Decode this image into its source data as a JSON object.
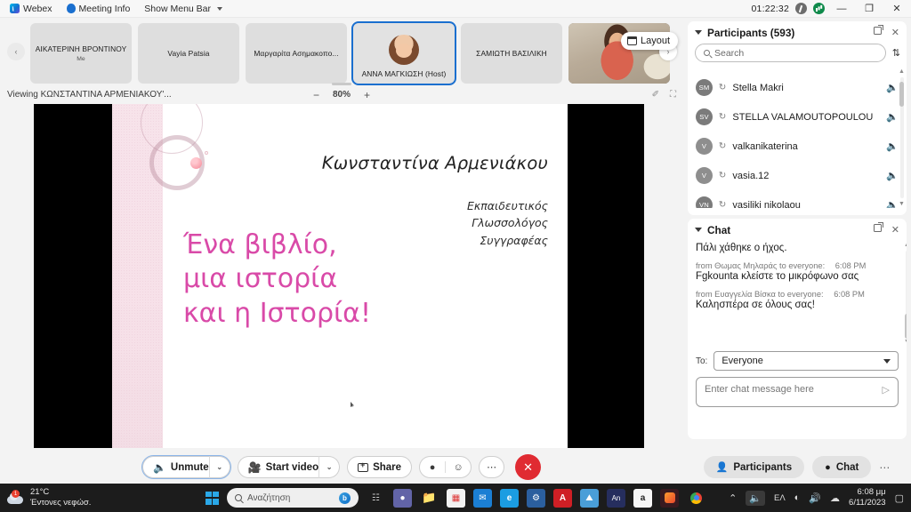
{
  "titlebar": {
    "app_name": "Webex",
    "meeting_info": "Meeting Info",
    "show_menu_bar": "Show Menu Bar",
    "timer": "01:22:32",
    "minimize": "—",
    "maximize": "❐",
    "close": "✕"
  },
  "thumbnails": {
    "prev_arrow": "‹",
    "next_arrow": "›",
    "layout_label": "Layout",
    "items": [
      {
        "name": "ΑΙΚΑΤΕΡΙΝΗ ΒΡΟΝΤΙΝΟΥ",
        "sub": "Me",
        "active": false,
        "video": false
      },
      {
        "name": "Vayia Patsia",
        "sub": "",
        "active": false,
        "video": false
      },
      {
        "name": "Μαργαρίτα Ασημακοπο...",
        "sub": "",
        "active": false,
        "video": false
      },
      {
        "name": "ΑΝΝΑ ΜΑΓΚΙΩΣΗ (Host)",
        "sub": "",
        "active": true,
        "video": false
      },
      {
        "name": "ΣΑΜΙΩΤΗ ΒΑΣΙΛΙΚΗ",
        "sub": "",
        "active": false,
        "video": false
      },
      {
        "name": "",
        "sub": "",
        "active": false,
        "video": true
      }
    ]
  },
  "viewbar": {
    "viewing_label": "Viewing ΚΩΝΣΤΑΝΤΙΝΑ ΑΡΜΕΝΙΑΚΟΥ'...",
    "zoom_out": "−",
    "zoom_level": "80%",
    "zoom_in": "+",
    "annotate_icon": "✐",
    "fullscreen_icon": "⛶"
  },
  "slide": {
    "author": "Κωνσταντίνα Αρμενιάκου",
    "role1": "Εκπαιδευτικός",
    "role2": "Γλωσσολόγος",
    "role3": "Συγγραφέας",
    "line1": "Ένα βιβλίο,",
    "line2": "μια ιστορία",
    "line3": "και η Ιστορία!",
    "title_color": "#d94aa8"
  },
  "controls": {
    "unmute": "Unmute",
    "unmute_chevron": "⌄",
    "start_video": "Start video",
    "video_chevron": "⌄",
    "share": "Share",
    "reactions_icon": "●",
    "emoji_icon": "☺",
    "more_icon": "⋯",
    "end_icon": "✕"
  },
  "participants_panel": {
    "title": "Participants (593)",
    "search_placeholder": "Search",
    "sort_icon": "⇅",
    "popout_icon": "popout",
    "close_icon": "✕",
    "list": [
      {
        "initials": "SM",
        "name": "Stella Makri",
        "muted": true
      },
      {
        "initials": "SV",
        "name": "STELLA VALAMOUTOPOULOU",
        "muted": true
      },
      {
        "initials": "V",
        "name": "valkanikaterina",
        "muted": true
      },
      {
        "initials": "V",
        "name": "vasia.12",
        "muted": true
      },
      {
        "initials": "VN",
        "name": "vasiliki nikolaou",
        "muted": true
      }
    ]
  },
  "chat_panel": {
    "title": "Chat",
    "close_icon": "✕",
    "messages": [
      {
        "meta": "",
        "time": "",
        "body": "Πάλι χάθηκε ο ήχος."
      },
      {
        "meta": "from Θωμας Μηλαράς to everyone:",
        "time": "6:08 PM",
        "body": "Fgkounta κλείστε το μικρόφωνο σας"
      },
      {
        "meta": "from Ευαγγελία Βίσκα to everyone:",
        "time": "6:08 PM",
        "body": "Καλησπέρα σε όλους σας!"
      }
    ],
    "to_label": "To:",
    "to_value": "Everyone",
    "input_placeholder": "Enter chat message here",
    "send_icon": "▷"
  },
  "right_bottom": {
    "participants": "Participants",
    "chat": "Chat",
    "more": "⋯"
  },
  "taskbar": {
    "weather_temp": "21°C",
    "weather_desc": "Έντονες νεφώσ.",
    "weather_badge": "1",
    "search_placeholder": "Αναζήτηση",
    "apps": [
      {
        "name": "task-view",
        "glyph": "❐",
        "color": "#c9c9c9",
        "bg": "transparent"
      },
      {
        "name": "teams",
        "glyph": "■",
        "color": "#fff",
        "bg": "#6264a7"
      },
      {
        "name": "file-explorer",
        "glyph": "▰",
        "color": "#ffc83d",
        "bg": "transparent"
      },
      {
        "name": "microsoft-store",
        "glyph": "▣",
        "color": "#fff",
        "bg": "#f2f2f2"
      },
      {
        "name": "mail",
        "glyph": "✉",
        "color": "#fff",
        "bg": "#1b7fd4"
      },
      {
        "name": "edge",
        "glyph": "e",
        "color": "#fff",
        "bg": "#1b9de2"
      },
      {
        "name": "settings",
        "glyph": "⚙",
        "color": "#fff",
        "bg": "#2b5f9e"
      },
      {
        "name": "adobe-reader",
        "glyph": "A",
        "color": "#fff",
        "bg": "#cf1f25"
      },
      {
        "name": "photos",
        "glyph": "◰",
        "color": "#fff",
        "bg": "#4a9ed8"
      },
      {
        "name": "anydesk",
        "glyph": "An",
        "color": "#fff",
        "bg": "#262e5e"
      },
      {
        "name": "amazon",
        "glyph": "a",
        "color": "#222",
        "bg": "#f6f6f6"
      },
      {
        "name": "webex",
        "glyph": "w",
        "color": "#fff",
        "bg": "#3a1a20"
      },
      {
        "name": "chrome",
        "glyph": "◉",
        "color": "#fff",
        "bg": "transparent"
      }
    ],
    "tray_up": "⌃",
    "mic_muted_icon": "mic-off",
    "lang": "ΕΛ",
    "wifi": "◠",
    "volume": "🔊",
    "onedrive": "☁",
    "time": "6:08 μμ",
    "date": "6/11/2023",
    "notification": "🔔"
  }
}
